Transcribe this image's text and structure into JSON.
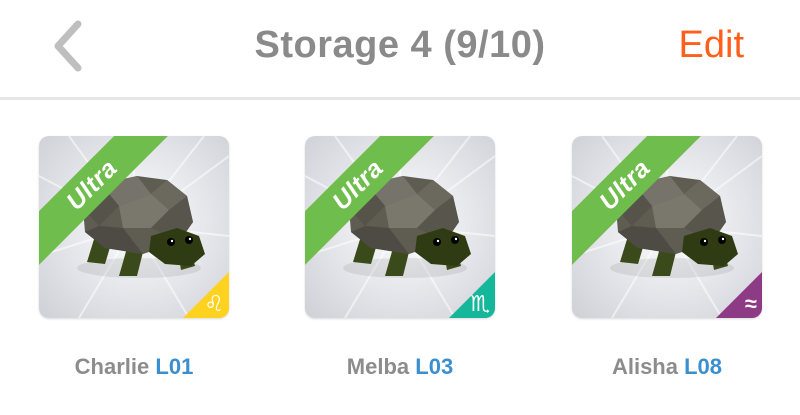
{
  "header": {
    "title": "Storage 4 (9/10)",
    "edit_label": "Edit"
  },
  "colors": {
    "accent": "#ff5f1a",
    "ribbon": "#6fbd4c",
    "level_text": "#3b8fcf"
  },
  "pets": [
    {
      "badge": "Ultra",
      "name": "Charlie",
      "level": "L01",
      "sign": "♌",
      "sign_color": "#ffd21f",
      "icon": "turtle-icon"
    },
    {
      "badge": "Ultra",
      "name": "Melba",
      "level": "L03",
      "sign": "♏",
      "sign_color": "#14b79a",
      "icon": "turtle-icon"
    },
    {
      "badge": "Ultra",
      "name": "Alisha",
      "level": "L08",
      "sign": "≈",
      "sign_color": "#8e3b86",
      "icon": "turtle-icon"
    }
  ]
}
